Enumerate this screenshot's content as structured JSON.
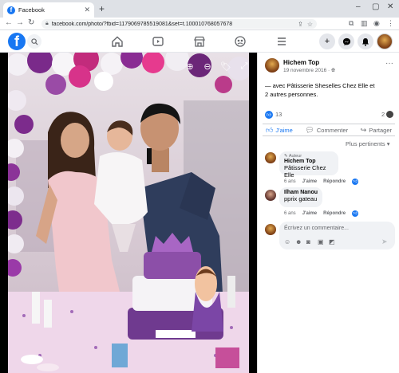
{
  "browser": {
    "tab_title": "Facebook",
    "url": "facebook.com/photo/?fbid=1179069785519081&set=t.100010768057678"
  },
  "post": {
    "poster_name": "Hichem Top",
    "date": "19 novembre 2016 · ",
    "text_line1": "— avec Pâtisserie Sheselles Chez Elle et",
    "text_line2": "2 autres personnes.",
    "like_count": "13",
    "share_count": "2"
  },
  "actions": {
    "like": "J'aime",
    "comment": "Commenter",
    "share": "Partager"
  },
  "sort_label": "Plus pertinents ▾",
  "comments": [
    {
      "badge": "✎ Auteur",
      "name": "Hichem Top",
      "text": "Pâtisserie Chez Elle",
      "age": "6 ans",
      "like": "J'aime",
      "reply": "Répondre"
    },
    {
      "name": "Ilham Nanou",
      "text": "pprix gateau",
      "age": "6 ans",
      "like": "J'aime",
      "reply": "Répondre"
    }
  ],
  "composer": {
    "placeholder": "Écrivez un commentaire..."
  },
  "colors": {
    "facebook_blue": "#1877f2",
    "comment_bubble": "#f0f2f5"
  },
  "icons": [
    "search-icon",
    "home-icon",
    "watch-icon",
    "marketplace-icon",
    "groups-icon",
    "menu-icon",
    "plus-icon",
    "messenger-icon",
    "bell-icon",
    "zoom-in-icon",
    "zoom-out-icon",
    "tag-icon",
    "fullscreen-icon"
  ]
}
